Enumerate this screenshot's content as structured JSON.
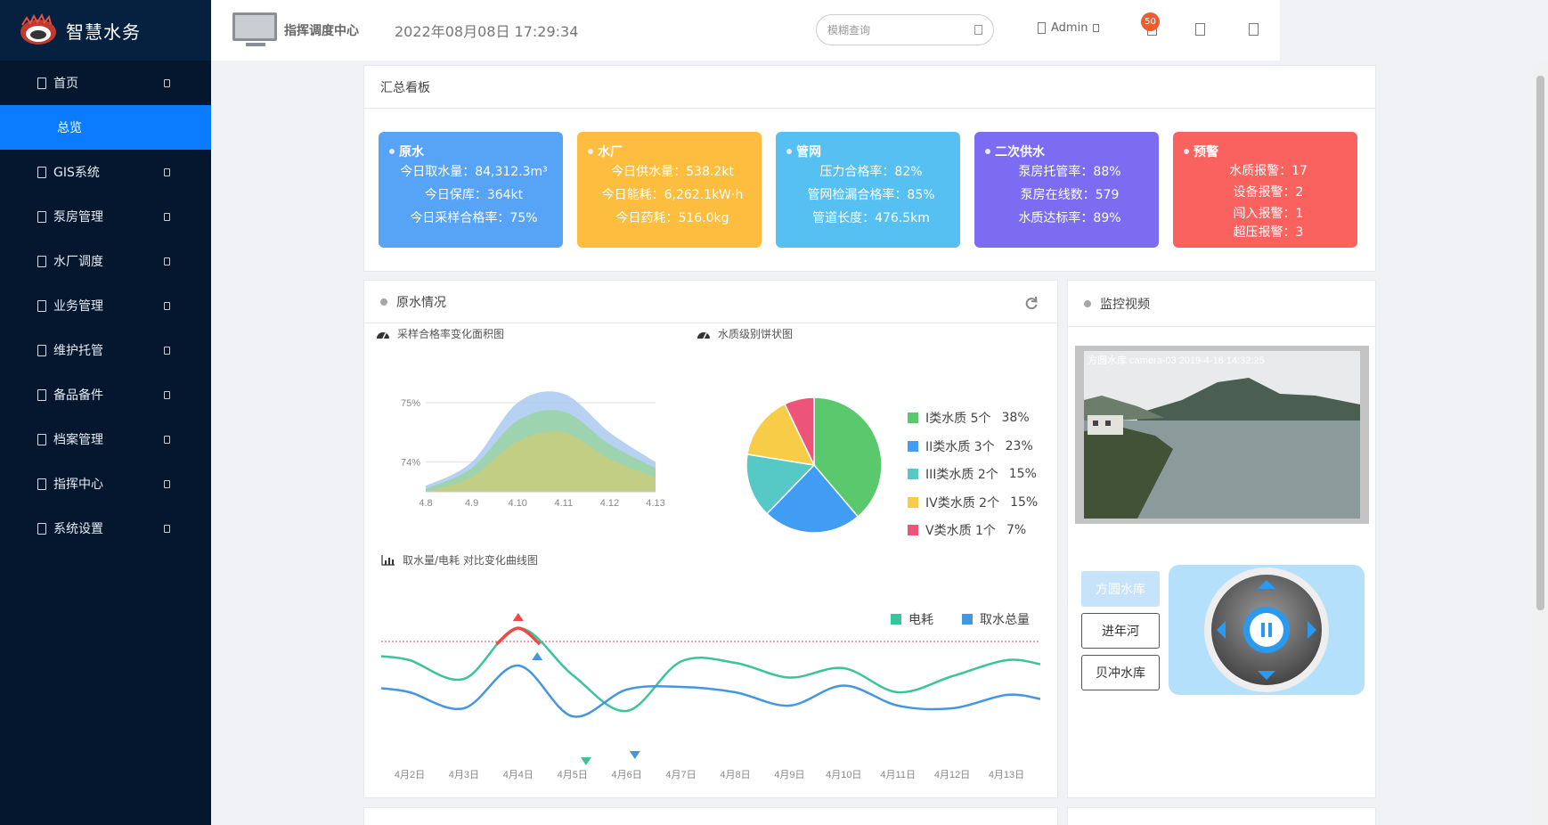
{
  "app": {
    "title": "智慧水务"
  },
  "sidebar": {
    "items": [
      {
        "label": "首页"
      },
      {
        "label": "总览"
      },
      {
        "label": "GIS系统"
      },
      {
        "label": "泵房管理"
      },
      {
        "label": "水厂调度"
      },
      {
        "label": "业务管理"
      },
      {
        "label": "维护托管"
      },
      {
        "label": "备品备件"
      },
      {
        "label": "档案管理"
      },
      {
        "label": "指挥中心"
      },
      {
        "label": "系统设置"
      }
    ]
  },
  "header": {
    "title": "指挥调度中心",
    "datetime": "2022年08月08日 17:29:34",
    "search_placeholder": "模糊查询",
    "user": "Admin",
    "badge": "50"
  },
  "summary": {
    "title": "汇总看板",
    "cards": [
      {
        "title": "原水",
        "color": "#57a3f5",
        "lines": [
          "今日取水量：84,312.3m³",
          "今日保库：364kt",
          "今日采样合格率：75%"
        ]
      },
      {
        "title": "水厂",
        "color": "#fdbd3e",
        "lines": [
          "今日供水量：538.2kt",
          "今日能耗：6,262.1kW·h",
          "今日药耗：516.0kg"
        ]
      },
      {
        "title": "管网",
        "color": "#56c0f2",
        "lines": [
          "压力合格率：82%",
          "管网检漏合格率：85%",
          "管道长度：476.5km"
        ]
      },
      {
        "title": "二次供水",
        "color": "#7b6cf1",
        "lines": [
          "泵房托管率：88%",
          "泵房在线数：579",
          "水质达标率：89%"
        ]
      },
      {
        "title": "预警",
        "color": "#f9625e",
        "lines": [
          "水质报警：17",
          "设备报警：2",
          "闯入报警：1",
          "超压报警：3"
        ]
      }
    ]
  },
  "raw_water": {
    "title": "原水情况",
    "area_title": "采样合格率变化面积图",
    "pie_title": "水质级别饼状图",
    "line_title": "取水量/电耗 对比变化曲线图"
  },
  "monitor": {
    "title": "监控视频",
    "overlay": "方圆水库 camera-03 2019-4-16 14:32:25",
    "buttons": [
      "方圆水库",
      "进年河",
      "贝冲水库"
    ]
  },
  "chart_data": [
    {
      "type": "area",
      "title": "采样合格率变化面积图",
      "x": [
        "4.8",
        "4.9",
        "4.10",
        "4.11",
        "4.12",
        "4.13"
      ],
      "y_ticks": [
        "75%",
        "74%"
      ],
      "ylim": [
        73.5,
        75.3
      ],
      "series": [
        {
          "color": "#a9c9f0",
          "values": [
            73.6,
            74.0,
            75.0,
            75.15,
            74.5,
            74.0
          ]
        },
        {
          "color": "#9ad4a3",
          "values": [
            73.55,
            73.9,
            74.7,
            74.85,
            74.3,
            73.9
          ]
        },
        {
          "color": "#c8cc7c",
          "values": [
            73.5,
            73.75,
            74.35,
            74.5,
            74.05,
            73.75
          ]
        }
      ]
    },
    {
      "type": "pie",
      "title": "水质级别饼状图",
      "slices": [
        {
          "label": "I类水质",
          "count": "5个",
          "pct": "38%",
          "value": 38,
          "color": "#5ac86c"
        },
        {
          "label": "II类水质",
          "count": "3个",
          "pct": "23%",
          "value": 23,
          "color": "#419cf4"
        },
        {
          "label": "III类水质",
          "count": "2个",
          "pct": "15%",
          "value": 15,
          "color": "#56c8c6"
        },
        {
          "label": "IV类水质",
          "count": "2个",
          "pct": "15%",
          "value": 15,
          "color": "#f7cc46"
        },
        {
          "label": "V类水质",
          "count": "1个",
          "pct": "7%",
          "value": 7,
          "color": "#ec5577"
        }
      ]
    },
    {
      "type": "line",
      "title": "取水量/电耗 对比变化曲线图",
      "categories": [
        "4月2日",
        "4月3日",
        "4月4日",
        "4月5日",
        "4月6日",
        "4月7日",
        "4月8日",
        "4月9日",
        "4月10日",
        "4月11日",
        "4月12日",
        "4月13日"
      ],
      "series": [
        {
          "name": "电耗",
          "color": "#39c49b",
          "values": [
            66,
            52,
            90,
            55,
            28,
            65,
            64,
            53,
            60,
            42,
            54,
            66
          ]
        },
        {
          "name": "取水总量",
          "color": "#4596e0",
          "values": [
            42,
            30,
            62,
            24,
            44,
            46,
            42,
            32,
            47,
            32,
            30,
            40
          ]
        }
      ],
      "threshold": 80
    }
  ]
}
